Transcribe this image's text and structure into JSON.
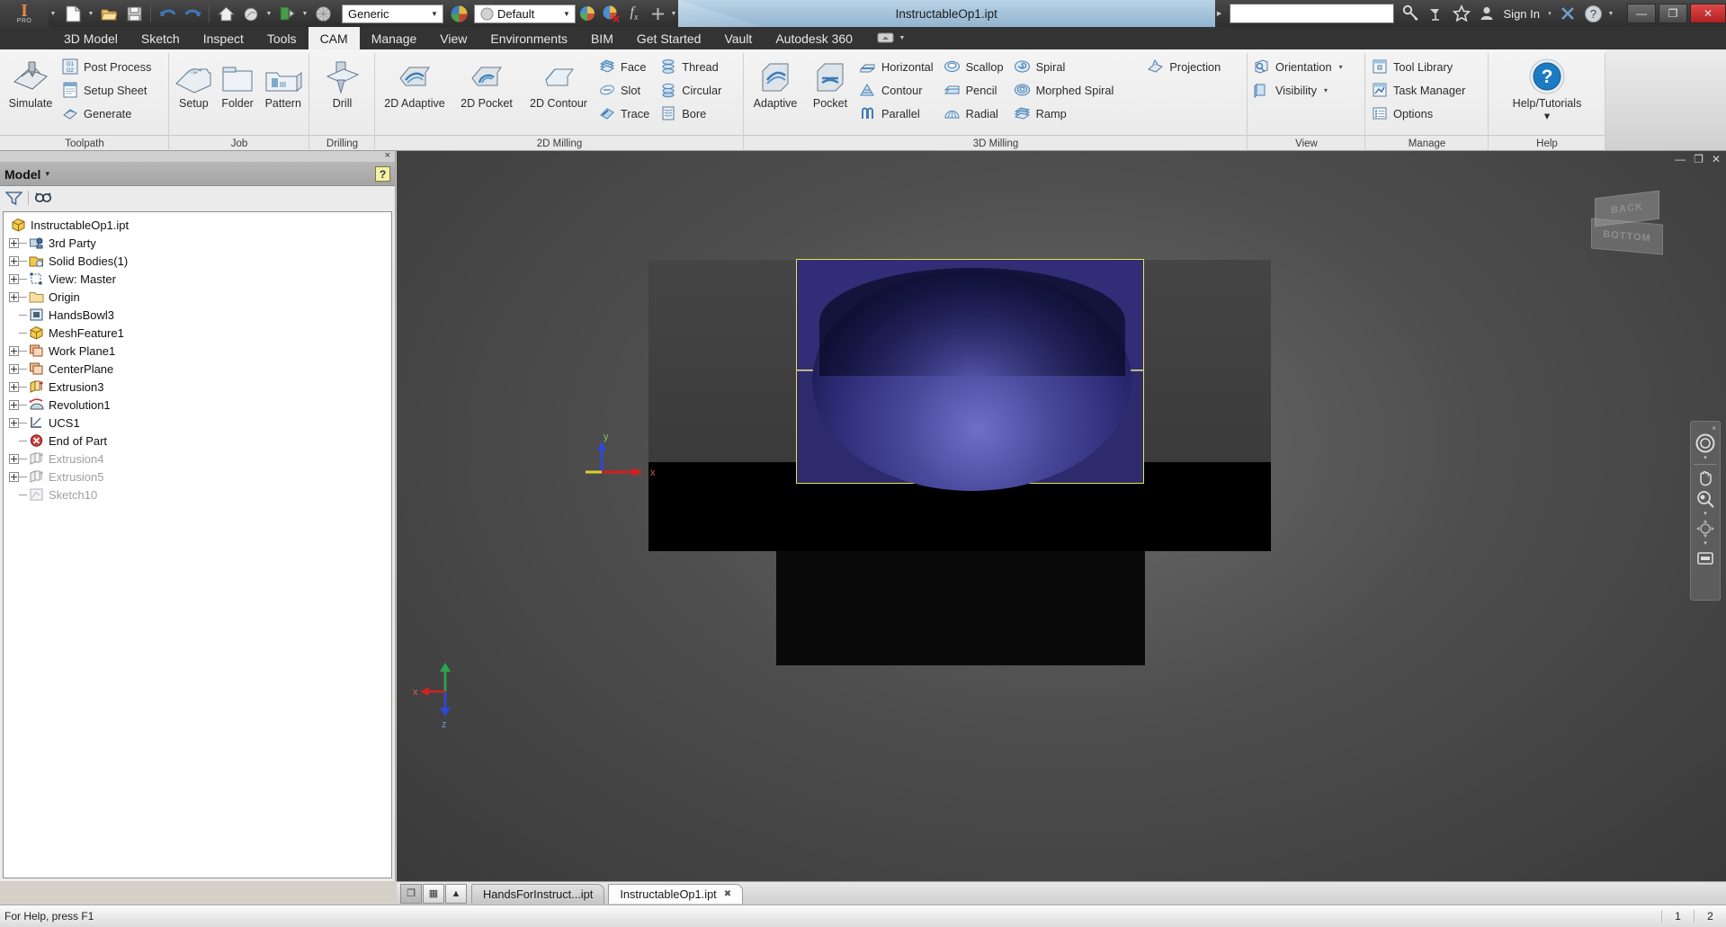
{
  "titlebar": {
    "logo_glyph": "I",
    "logo_sub": "PRO",
    "quick_access": [
      {
        "name": "new-file",
        "label": "New"
      },
      {
        "name": "open-file",
        "label": "Open"
      },
      {
        "name": "save-file",
        "label": "Save"
      },
      {
        "name": "undo",
        "label": "Undo"
      },
      {
        "name": "redo",
        "label": "Redo"
      },
      {
        "name": "home-view",
        "label": "Home View"
      },
      {
        "name": "appearance",
        "label": "Appearance"
      },
      {
        "name": "return",
        "label": "Return"
      },
      {
        "name": "shadow",
        "label": "Shadows"
      }
    ],
    "material_combo": {
      "value": "Generic",
      "placeholder": "Material"
    },
    "appearance_combo": {
      "value": "Default",
      "placeholder": "Appearance"
    },
    "document_title": "InstructableOp1.ipt",
    "search_value": "",
    "search_placeholder": "",
    "right_icons": [
      "key-icon",
      "satellite-icon",
      "star-icon",
      "person-icon"
    ],
    "sign_in_label": "Sign In",
    "sign_in_caret": "▾",
    "help_icon": "question-icon",
    "window_buttons": {
      "minimize": "—",
      "restore": "❐",
      "close": "✕"
    }
  },
  "ribbon_tabs": [
    {
      "label": "3D Model",
      "active": false
    },
    {
      "label": "Sketch",
      "active": false
    },
    {
      "label": "Inspect",
      "active": false
    },
    {
      "label": "Tools",
      "active": false
    },
    {
      "label": "CAM",
      "active": true
    },
    {
      "label": "Manage",
      "active": false
    },
    {
      "label": "View",
      "active": false
    },
    {
      "label": "Environments",
      "active": false
    },
    {
      "label": "BIM",
      "active": false
    },
    {
      "label": "Get Started",
      "active": false
    },
    {
      "label": "Vault",
      "active": false
    },
    {
      "label": "Autodesk 360",
      "active": false
    }
  ],
  "ribbon_panels": [
    {
      "name": "toolpath",
      "label": "Toolpath",
      "big": [
        {
          "label": "Simulate",
          "icon": "simulate-icon"
        }
      ],
      "small": [
        {
          "label": "Post Process",
          "icon": "post-process-icon"
        },
        {
          "label": "Setup Sheet",
          "icon": "setup-sheet-icon"
        },
        {
          "label": "Generate",
          "icon": "generate-icon"
        }
      ]
    },
    {
      "name": "job",
      "label": "Job",
      "big": [
        {
          "label": "Setup",
          "icon": "setup-icon"
        },
        {
          "label": "Folder",
          "icon": "folder-icon"
        },
        {
          "label": "Pattern",
          "icon": "pattern-icon"
        }
      ],
      "small": []
    },
    {
      "name": "drilling",
      "label": "Drilling",
      "big": [
        {
          "label": "Drill",
          "icon": "drill-icon"
        }
      ],
      "small": []
    },
    {
      "name": "2d-milling",
      "label": "2D Milling",
      "big": [
        {
          "label": "2D Adaptive",
          "icon": "2d-adaptive-icon"
        },
        {
          "label": "2D Pocket",
          "icon": "2d-pocket-icon"
        },
        {
          "label": "2D Contour",
          "icon": "2d-contour-icon"
        }
      ],
      "small_a": [
        {
          "label": "Face",
          "icon": "face-icon"
        },
        {
          "label": "Slot",
          "icon": "slot-icon"
        },
        {
          "label": "Trace",
          "icon": "trace-icon"
        }
      ],
      "small_b": [
        {
          "label": "Thread",
          "icon": "thread-icon"
        },
        {
          "label": "Circular",
          "icon": "circular-icon"
        },
        {
          "label": "Bore",
          "icon": "bore-icon"
        }
      ]
    },
    {
      "name": "3d-milling",
      "label": "3D Milling",
      "big": [
        {
          "label": "Adaptive",
          "icon": "adaptive-icon"
        },
        {
          "label": "Pocket",
          "icon": "pocket-icon"
        }
      ],
      "small_a": [
        {
          "label": "Horizontal",
          "icon": "horizontal-icon"
        },
        {
          "label": "Contour",
          "icon": "contour-icon"
        },
        {
          "label": "Parallel",
          "icon": "parallel-icon"
        }
      ],
      "small_b": [
        {
          "label": "Scallop",
          "icon": "scallop-icon"
        },
        {
          "label": "Pencil",
          "icon": "pencil-icon"
        },
        {
          "label": "Radial",
          "icon": "radial-icon"
        }
      ],
      "small_c": [
        {
          "label": "Spiral",
          "icon": "spiral-icon"
        },
        {
          "label": "Morphed Spiral",
          "icon": "morphed-spiral-icon"
        },
        {
          "label": "Ramp",
          "icon": "ramp-icon"
        }
      ],
      "small_d": [
        {
          "label": "Projection",
          "icon": "projection-icon"
        }
      ]
    },
    {
      "name": "view",
      "label": "View",
      "small": [
        {
          "label": "Orientation",
          "icon": "orientation-icon",
          "caret": "▾"
        },
        {
          "label": "Visibility",
          "icon": "visibility-icon",
          "caret": "▾"
        }
      ]
    },
    {
      "name": "manage",
      "label": "Manage",
      "small": [
        {
          "label": "Tool Library",
          "icon": "tool-library-icon"
        },
        {
          "label": "Task Manager",
          "icon": "task-manager-icon"
        },
        {
          "label": "Options",
          "icon": "options-icon"
        }
      ]
    },
    {
      "name": "help",
      "label": "Help",
      "big": [
        {
          "label": "Help/Tutorials",
          "icon": "help-question-icon",
          "caret": "▾"
        }
      ],
      "small": []
    }
  ],
  "browser": {
    "title": "Model",
    "title_caret": "▾",
    "help_glyph": "?",
    "close_glyph": "×",
    "tools": [
      {
        "name": "filter-icon",
        "label": "Filter"
      },
      {
        "name": "find-icon",
        "label": "Find"
      }
    ],
    "tree": [
      {
        "label": "InstructableOp1.ipt",
        "icon": "part-cube-icon",
        "indent": 0,
        "expand": "none",
        "dim": false
      },
      {
        "label": "3rd Party",
        "icon": "third-party-icon",
        "indent": 1,
        "expand": "plus",
        "dim": false
      },
      {
        "label": "Solid Bodies(1)",
        "icon": "solid-bodies-icon",
        "indent": 1,
        "expand": "plus",
        "dim": false
      },
      {
        "label": "View: Master",
        "icon": "view-master-icon",
        "indent": 1,
        "expand": "plus",
        "dim": false
      },
      {
        "label": "Origin",
        "icon": "folder-icon",
        "indent": 1,
        "expand": "plus",
        "dim": false
      },
      {
        "label": "HandsBowl3",
        "icon": "mesh-icon",
        "indent": 1,
        "expand": "leaf",
        "dim": false
      },
      {
        "label": "MeshFeature1",
        "icon": "part-cube-icon",
        "indent": 1,
        "expand": "leaf",
        "dim": false
      },
      {
        "label": "Work Plane1",
        "icon": "work-plane-icon",
        "indent": 1,
        "expand": "plus",
        "dim": false
      },
      {
        "label": "CenterPlane",
        "icon": "work-plane-icon",
        "indent": 1,
        "expand": "plus",
        "dim": false
      },
      {
        "label": "Extrusion3",
        "icon": "extrusion-icon",
        "indent": 1,
        "expand": "plus",
        "dim": false
      },
      {
        "label": "Revolution1",
        "icon": "revolution-icon",
        "indent": 1,
        "expand": "plus",
        "dim": false
      },
      {
        "label": "UCS1",
        "icon": "ucs-icon",
        "indent": 1,
        "expand": "plus",
        "dim": false
      },
      {
        "label": "End of Part",
        "icon": "end-of-part-icon",
        "indent": 1,
        "expand": "leaf",
        "dim": false
      },
      {
        "label": "Extrusion4",
        "icon": "extrusion-icon",
        "indent": 1,
        "expand": "plus",
        "dim": true
      },
      {
        "label": "Extrusion5",
        "icon": "extrusion-icon",
        "indent": 1,
        "expand": "plus",
        "dim": true
      },
      {
        "label": "Sketch10",
        "icon": "sketch-icon",
        "indent": 1,
        "expand": "leaf",
        "dim": true
      }
    ]
  },
  "viewport": {
    "window_buttons": {
      "minimize": "—",
      "restore": "❐",
      "close": "✕"
    },
    "viewcube": {
      "top_face": "BACK",
      "bottom_face": "BOTTOM"
    },
    "navbar": {
      "close_glyph": "×",
      "items": [
        {
          "name": "steering-wheel-icon",
          "glyph": "◎"
        },
        {
          "name": "pan-hand-icon",
          "glyph": "✋"
        },
        {
          "name": "zoom-icon",
          "glyph": "⌕"
        },
        {
          "name": "orbit-icon",
          "glyph": "✥"
        },
        {
          "name": "look-at-icon",
          "glyph": "▤"
        }
      ],
      "caret": "▾"
    },
    "axis_labels": {
      "x": "x",
      "y": "y"
    },
    "ucs_labels": {
      "x": "x",
      "z": "z"
    },
    "colors": {
      "selection_outline": "#e9e14b",
      "selected_face": "#312d76",
      "bowl_highlight": "#6f6fc8",
      "stock": "#414141"
    }
  },
  "tabbar": {
    "buttons": [
      {
        "name": "cascade-windows-button",
        "glyph": "❐",
        "active": true
      },
      {
        "name": "tile-windows-button",
        "glyph": "▦",
        "active": false
      },
      {
        "name": "tab-scroll-up-button",
        "glyph": "▲",
        "active": false
      }
    ],
    "tabs": [
      {
        "label": "HandsForInstruct...ipt",
        "active": false,
        "closable": false
      },
      {
        "label": "InstructableOp1.ipt",
        "active": true,
        "closable": true,
        "close_glyph": "✖"
      }
    ]
  },
  "statusbar": {
    "message": "For Help, press F1",
    "right_cells": [
      "1",
      "2"
    ]
  }
}
